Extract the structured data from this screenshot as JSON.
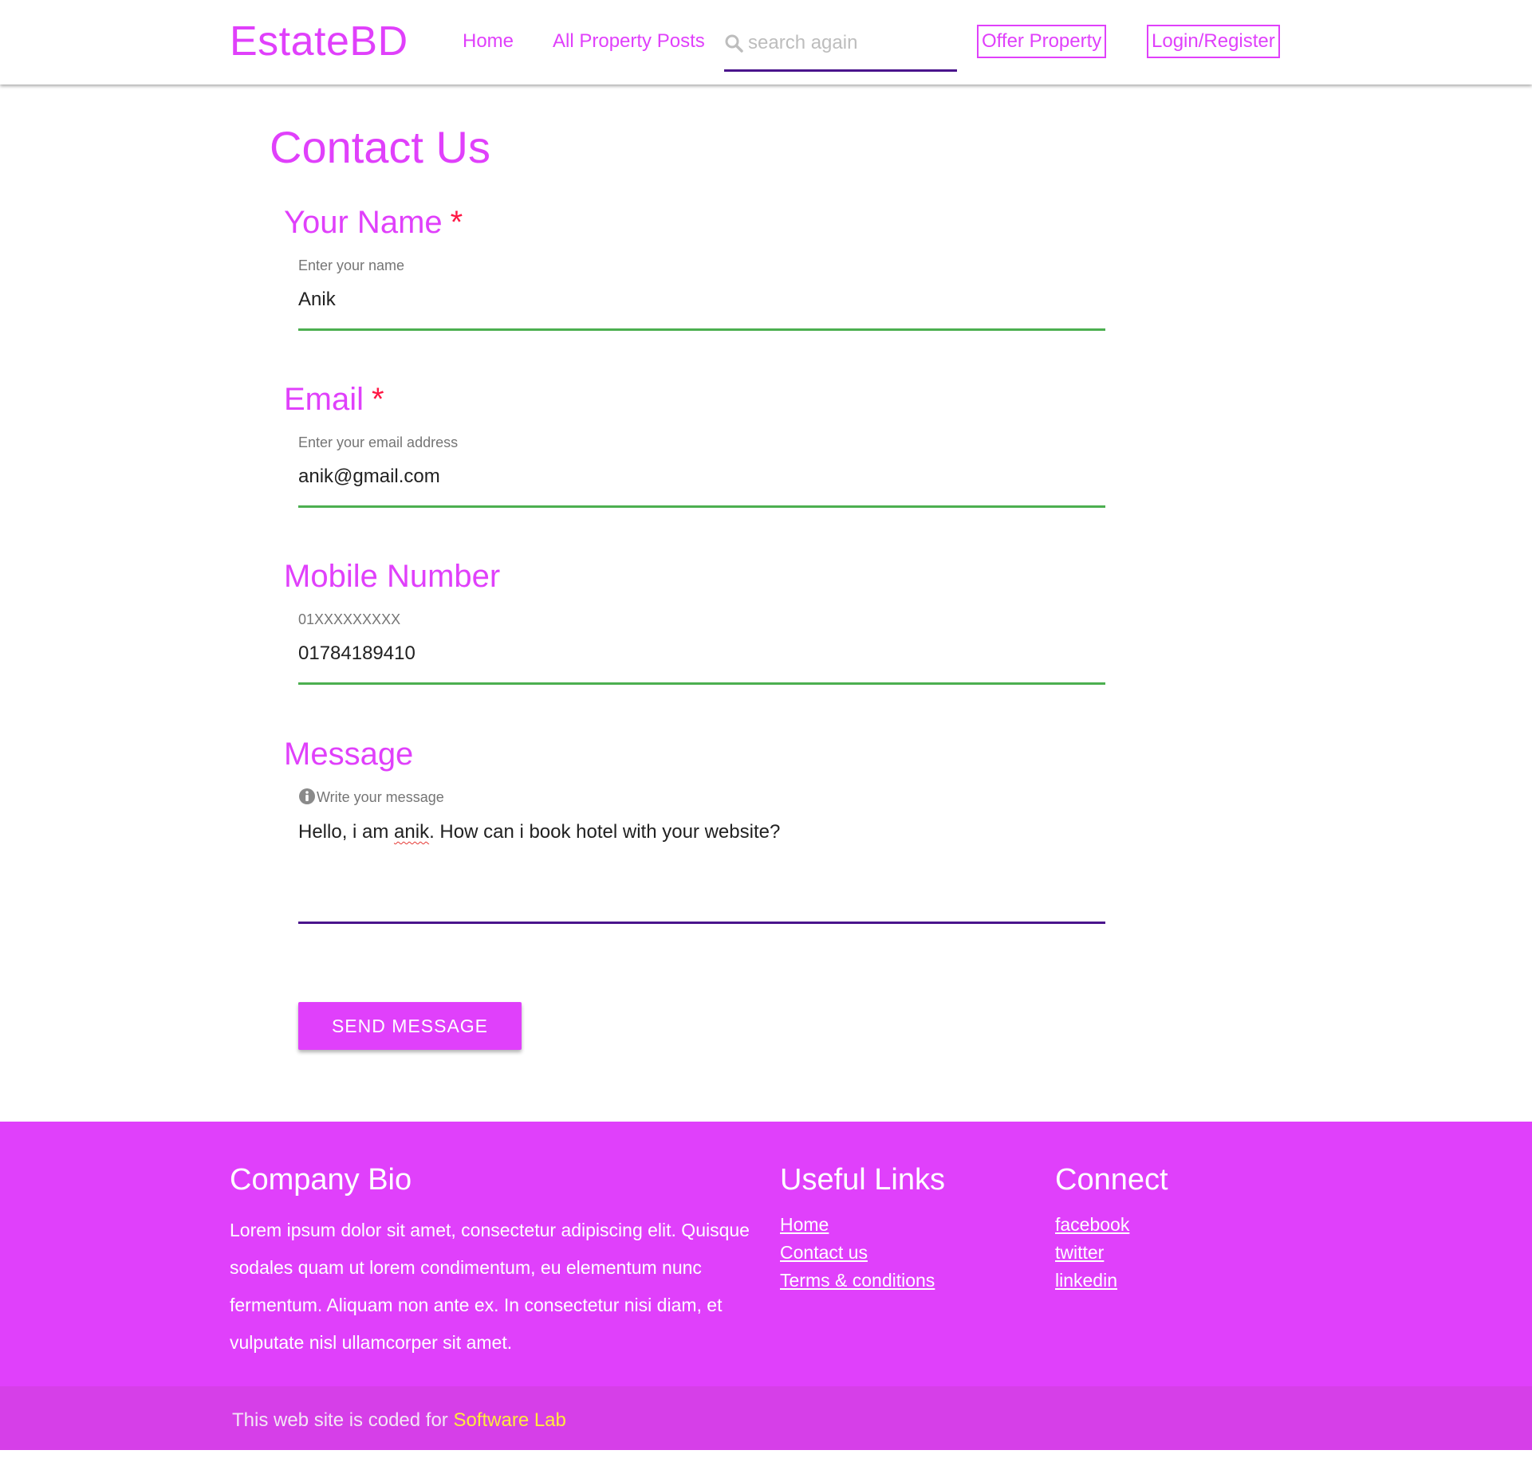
{
  "header": {
    "brand": "EstateBD",
    "nav": {
      "home": "Home",
      "all_posts": "All Property Posts"
    },
    "search": {
      "placeholder": "search again",
      "value": ""
    },
    "offer_property": "Offer Property",
    "login_register": "Login/Register"
  },
  "main": {
    "title": "Contact Us",
    "fields": {
      "name": {
        "label": "Your Name",
        "required_mark": "*",
        "hint": "Enter your name",
        "value": "Anik"
      },
      "email": {
        "label": "Email",
        "required_mark": "*",
        "hint": "Enter your email address",
        "value": "anik@gmail.com"
      },
      "mobile": {
        "label": "Mobile Number",
        "hint": "01XXXXXXXXX",
        "value": "01784189410"
      },
      "message": {
        "label": "Message",
        "hint": "Write your message",
        "value_before": "Hello, i am ",
        "value_misspelled": "anik",
        "value_after": ". How can i book hotel with your website?"
      }
    },
    "send_button": "SEND MESSAGE"
  },
  "footer": {
    "bio": {
      "title": "Company Bio",
      "text": "Lorem ipsum dolor sit amet, consectetur adipiscing elit. Quisque sodales quam ut lorem condimentum, eu elementum nunc fermentum. Aliquam non ante ex. In consectetur nisi diam, et vulputate nisl ullamcorper sit amet."
    },
    "useful_links": {
      "title": "Useful Links",
      "items": [
        "Home",
        "Contact us",
        "Terms & conditions"
      ]
    },
    "connect": {
      "title": "Connect",
      "items": [
        "facebook",
        "twitter",
        "linkedin"
      ]
    },
    "copyright": {
      "prefix": "This web site is coded for ",
      "highlight": "Software Lab"
    }
  },
  "colors": {
    "accent": "#e040fb",
    "footer_bottom": "#d63fe8",
    "valid_line": "#4caf50",
    "active_line": "#4a148c",
    "required": "#ff1744",
    "copyright_highlight": "#ffeb3b"
  },
  "icons": {
    "search": "search-icon",
    "info": "info-icon"
  }
}
